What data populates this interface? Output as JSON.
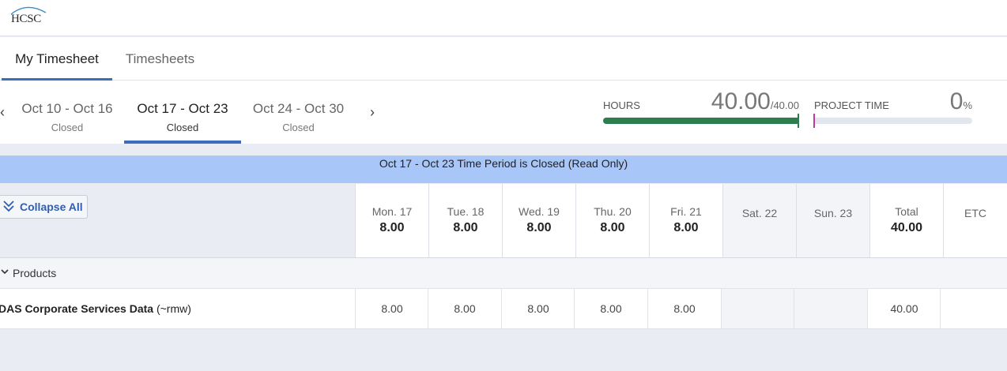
{
  "app": {
    "logo_text": "HCSC"
  },
  "tabs": [
    {
      "label": "My Timesheet",
      "active": true
    },
    {
      "label": "Timesheets",
      "active": false
    }
  ],
  "periods": [
    {
      "dates": "Oct 10 - Oct 16",
      "status": "Closed",
      "active": false
    },
    {
      "dates": "Oct 17 - Oct 23",
      "status": "Closed",
      "active": true
    },
    {
      "dates": "Oct 24 - Oct 30",
      "status": "Closed",
      "active": false
    }
  ],
  "nav": {
    "prev_icon": "chevron-left-icon",
    "next_icon": "chevron-right-icon"
  },
  "hours_meter": {
    "label": "HOURS",
    "value": "40.00",
    "max": "/40.00",
    "fill_percent": 100,
    "color": "#2e7d4f"
  },
  "project_meter": {
    "label": "PROJECT TIME",
    "value": "0",
    "unit": "%",
    "fill_percent": 0,
    "tick_color": "#c0399b"
  },
  "banner": {
    "text": "Oct 17 - Oct 23 Time Period is Closed (Read Only)",
    "color": "#a8c6f7"
  },
  "toolbar": {
    "collapse_label": "Collapse All"
  },
  "columns": [
    {
      "name": "Mon. 17",
      "total": "8.00",
      "weekend": false
    },
    {
      "name": "Tue. 18",
      "total": "8.00",
      "weekend": false
    },
    {
      "name": "Wed. 19",
      "total": "8.00",
      "weekend": false
    },
    {
      "name": "Thu. 20",
      "total": "8.00",
      "weekend": false
    },
    {
      "name": "Fri. 21",
      "total": "8.00",
      "weekend": false
    },
    {
      "name": "Sat. 22",
      "total": "",
      "weekend": true
    },
    {
      "name": "Sun. 23",
      "total": "",
      "weekend": true
    },
    {
      "name": "Total",
      "total": "40.00",
      "weekend": false
    },
    {
      "name": "ETC",
      "total": "",
      "weekend": false
    }
  ],
  "group": {
    "name": "Products"
  },
  "rows": [
    {
      "name": "DAS Corporate Services Data",
      "suffix": " (~rmw)",
      "cells": [
        "8.00",
        "8.00",
        "8.00",
        "8.00",
        "8.00",
        "",
        "",
        "40.00",
        ""
      ]
    }
  ],
  "colors": {
    "accent": "#3b6cc0",
    "link": "#2f5fb3"
  }
}
